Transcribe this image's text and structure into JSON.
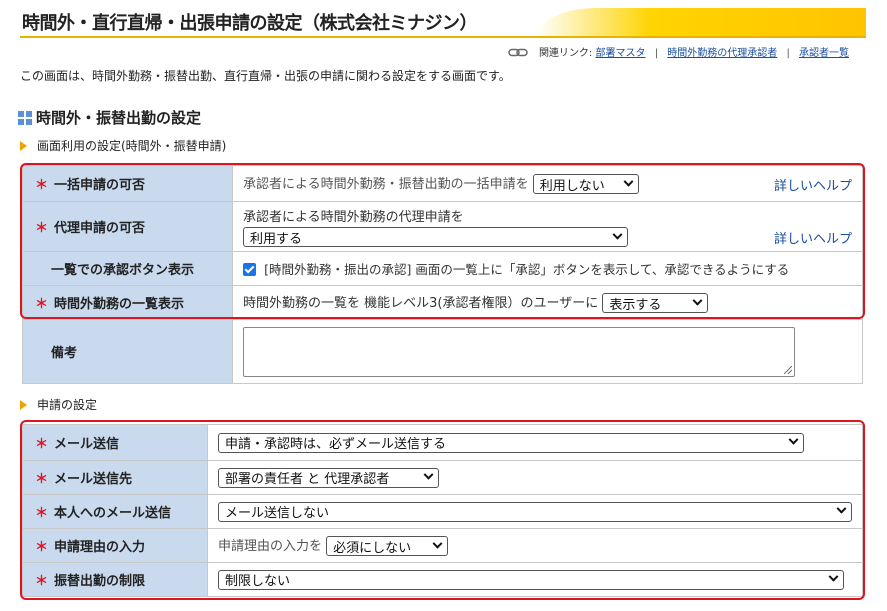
{
  "header": {
    "title": "時間外・直行直帰・出張申請の設定（株式会社ミナジン）",
    "related_label": "関連リンク:",
    "related_links": [
      "部署マスタ",
      "時間外勤務の代理承認者",
      "承認者一覧"
    ],
    "intro": "この画面は、時間外勤務・振替出勤、直行直帰・出張の申請に関わる設定をする画面です。"
  },
  "section1": {
    "title": "時間外・振替出勤の設定",
    "subtitle": "画面利用の設定(時間外・振替申請)",
    "rows": [
      {
        "label": "一括申請の可否",
        "text": "承認者による時間外勤務・振替出勤の一括申請を",
        "select": "利用しない",
        "help": "詳しいヘルプ"
      },
      {
        "label": "代理申請の可否",
        "text": "承認者による時間外勤務の代理申請を",
        "select": "利用する",
        "help": "詳しいヘルプ"
      },
      {
        "label": "一覧での承認ボタン表示",
        "text": "[時間外勤務・振出の承認] 画面の一覧上に「承認」ボタンを表示して、承認できるようにする"
      },
      {
        "label": "時間外勤務の一覧表示",
        "text": "時間外勤務の一覧を  機能レベル3(承認者権限）のユーザーに",
        "select": "表示する"
      }
    ],
    "memo_label": "備考"
  },
  "section2": {
    "subtitle": "申請の設定",
    "rows": [
      {
        "label": "メール送信",
        "select": "申請・承認時は、必ずメール送信する"
      },
      {
        "label": "メール送信先",
        "select": "部署の責任者 と 代理承認者"
      },
      {
        "label": "本人へのメール送信",
        "select": "メール送信しない"
      },
      {
        "label": "申請理由の入力",
        "text": "申請理由の入力を",
        "select": "必須にしない"
      },
      {
        "label": "振替出勤の制限",
        "select": "制限しない"
      }
    ]
  },
  "required_mark": "＊",
  "colors": {
    "required": "#e0141e",
    "label_bg": "#c9d9ee",
    "link": "#1a4ea0",
    "accent": "#ffd400"
  }
}
